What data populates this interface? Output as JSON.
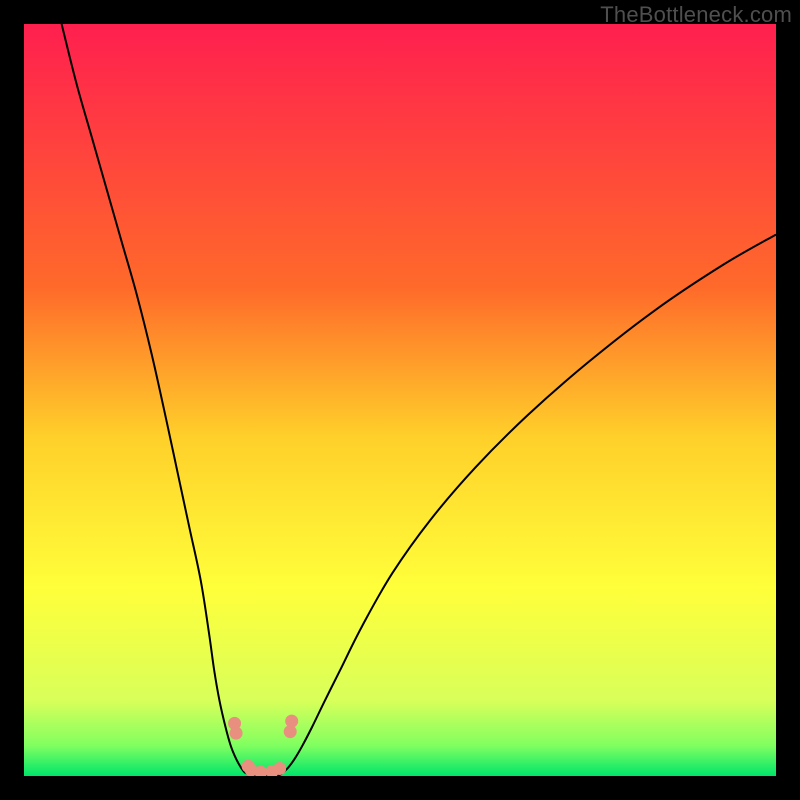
{
  "watermark": "TheBottleneck.com",
  "chart_data": {
    "type": "line",
    "title": "",
    "xlabel": "",
    "ylabel": "",
    "xlim": [
      0,
      100
    ],
    "ylim": [
      0,
      100
    ],
    "gradient_stops": [
      {
        "offset": 0,
        "color": "#ff1f4f"
      },
      {
        "offset": 35,
        "color": "#ff6a2a"
      },
      {
        "offset": 55,
        "color": "#ffd02a"
      },
      {
        "offset": 75,
        "color": "#ffff3a"
      },
      {
        "offset": 90,
        "color": "#d8ff5a"
      },
      {
        "offset": 96,
        "color": "#7fff60"
      },
      {
        "offset": 100,
        "color": "#00e56a"
      }
    ],
    "series": [
      {
        "name": "left-branch",
        "x": [
          5,
          7,
          9,
          11,
          13,
          15,
          17,
          19,
          20.5,
          22,
          23.5,
          24.6,
          25.3,
          26,
          26.8,
          27.5,
          28.2,
          28.8,
          29.3
        ],
        "y": [
          100,
          92,
          85,
          78,
          71,
          64,
          56,
          47,
          40,
          33,
          26,
          19,
          14,
          10,
          6.5,
          4,
          2.3,
          1.2,
          0.5
        ]
      },
      {
        "name": "right-branch",
        "x": [
          34.5,
          35.2,
          36,
          37,
          38.3,
          40,
          42,
          45,
          49,
          54,
          60,
          67,
          75,
          84,
          93,
          100
        ],
        "y": [
          0.5,
          1.2,
          2.3,
          4,
          6.5,
          10,
          14,
          20,
          27,
          34,
          41,
          48,
          55,
          62,
          68,
          72
        ]
      },
      {
        "name": "valley-floor",
        "x": [
          29.3,
          30,
          31,
          32,
          33,
          34,
          34.5
        ],
        "y": [
          0.5,
          0.15,
          0.05,
          0.03,
          0.05,
          0.15,
          0.5
        ]
      }
    ],
    "markers": [
      {
        "x": 28.0,
        "y": 7.0
      },
      {
        "x": 28.2,
        "y": 5.7
      },
      {
        "x": 29.8,
        "y": 1.3
      },
      {
        "x": 30.2,
        "y": 0.8
      },
      {
        "x": 31.5,
        "y": 0.5
      },
      {
        "x": 33.0,
        "y": 0.6
      },
      {
        "x": 34.0,
        "y": 1.0
      },
      {
        "x": 35.4,
        "y": 5.9
      },
      {
        "x": 35.6,
        "y": 7.3
      }
    ],
    "marker_color": "#e88f80",
    "curve_color": "#000000"
  }
}
